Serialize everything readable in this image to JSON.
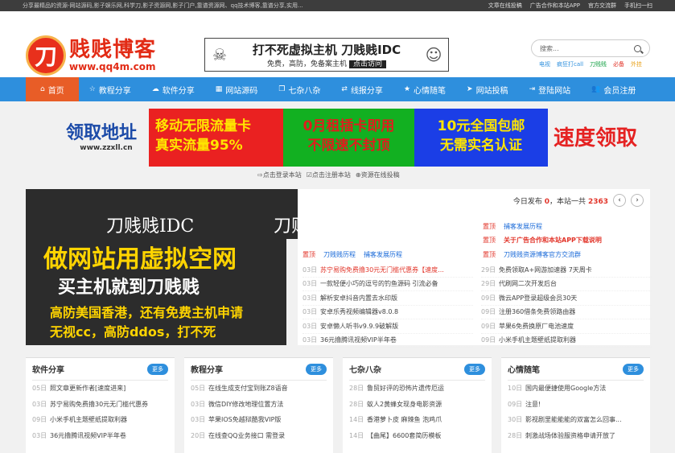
{
  "topbar": {
    "left_text": "分享最精品的资源-网站源码,影子娱乐网,科学刀,影子资源网,影子门户,靠谱资源网、qq技术博客,靠谱分享,实用...",
    "links": [
      "文章在线投稿",
      "广告合作和本站APP",
      "官方交流群",
      "手机扫一扫"
    ]
  },
  "logo": {
    "mark": "刀",
    "title": "贱贱博客",
    "url": "www.qq4m.com"
  },
  "top_ad": {
    "line1": "打不死虚拟主机 刀贱贱IDC",
    "line2": "免费，高防，免备案主机",
    "button": "点击访问"
  },
  "search": {
    "placeholder": "搜索..."
  },
  "hot_tags": [
    "电视",
    "疯狂打call",
    "刀贱贱",
    "必备",
    "外挂"
  ],
  "nav": [
    {
      "icon": "home-icon",
      "glyph": "⌂",
      "label": "首页"
    },
    {
      "icon": "star-icon",
      "glyph": "☆",
      "label": "教程分享"
    },
    {
      "icon": "cloud-icon",
      "glyph": "☁",
      "label": "软件分享"
    },
    {
      "icon": "grid-icon",
      "glyph": "▦",
      "label": "网站源码"
    },
    {
      "icon": "copy-icon",
      "glyph": "❐",
      "label": "七杂八杂"
    },
    {
      "icon": "share-icon",
      "glyph": "⇄",
      "label": "线报分享"
    },
    {
      "icon": "heart-icon",
      "glyph": "★",
      "label": "心情随笔"
    },
    {
      "icon": "send-icon",
      "glyph": "➤",
      "label": "网站投稿"
    },
    {
      "icon": "login-icon",
      "glyph": "⇥",
      "label": "登陆网站"
    },
    {
      "icon": "users-icon",
      "glyph": "👥",
      "label": "会员注册"
    }
  ],
  "banner": {
    "logo_text": "领取地址",
    "logo_url": "www.zzxll.cn",
    "red": [
      "移动无限流量卡",
      "真实流量95%"
    ],
    "green": [
      "0月租插卡即用",
      "不限速不封顶"
    ],
    "blue": [
      "10元全国包邮",
      "无需实名认证"
    ],
    "speed": "速度领取"
  },
  "sublinks": [
    "点击登录本站",
    "点击注册本站",
    "资源在线投稿"
  ],
  "slide": {
    "l1": "刀贱贱IDC",
    "l1b": "刀贱",
    "l2": "做网站用虚拟空网",
    "l3": "买主机就到刀贱贱",
    "l4": "高防美国香港，还有免费主机申请",
    "l5": "无视cc，高防ddos，打不死"
  },
  "news": {
    "today_label": "今日发布",
    "today_count": "0",
    "total_label": "本站一共",
    "total_count": "2363",
    "tag": "置顶",
    "tag_rows": [
      {
        "tag": "置顶",
        "title": "捕客发展历程"
      },
      {
        "tag": "置顶",
        "title": "刀贱贱历程",
        "title2": "捕客发展历程"
      },
      {
        "tag": "置顶",
        "title": "关于广告合作和本站APP下载说明"
      },
      {
        "tag": "置顶",
        "title": "刀贱贱资源博客官方交流群"
      }
    ],
    "left": [
      {
        "d": "03日",
        "t": "苏宁易购免费撸30元无门槛代惠券【速度..."
      },
      {
        "d": "03日",
        "t": "一款轻便小巧的逗号的钓鱼源码 引流必备"
      },
      {
        "d": "03日",
        "t": "解析安卓抖音内置去水印版"
      },
      {
        "d": "03日",
        "t": "安卓乐秀视频编辑器v8.0.8"
      },
      {
        "d": "03日",
        "t": "安卓懒人听书v9.9.9破解版"
      },
      {
        "d": "03日",
        "t": "36元撸腾讯视频VIP半年卷"
      }
    ],
    "right": [
      {
        "d": "29日",
        "t": "免费领取A+网游加速器 7天周卡"
      },
      {
        "d": "29日",
        "t": "代刷网二次开发后台"
      },
      {
        "d": "09日",
        "t": "微云APP登录超级会员30天"
      },
      {
        "d": "09日",
        "t": "注册360借条免费领路由器"
      },
      {
        "d": "09日",
        "t": "苹果6免费换原厂电池速度"
      },
      {
        "d": "09日",
        "t": "小米手机主题壁纸提取利器"
      }
    ]
  },
  "boxes": [
    {
      "title": "软件分享",
      "more": "更多",
      "rows": [
        {
          "d": "05日",
          "t": "照文章更新作者[速度进来]"
        },
        {
          "d": "03日",
          "t": "苏宁易购免费撸30元无门槛代惠券"
        },
        {
          "d": "09日",
          "t": "小米手机主题壁纸提取利器"
        },
        {
          "d": "03日",
          "t": "36元撸腾讯视频VIP半年卷"
        }
      ]
    },
    {
      "title": "教程分享",
      "more": "更多",
      "rows": [
        {
          "d": "05日",
          "t": "在线生成支付宝到账Z8语音"
        },
        {
          "d": "03日",
          "t": "微信DIY修改地理位置方法"
        },
        {
          "d": "03日",
          "t": "苹果IOS免越狱酷我VIP版"
        },
        {
          "d": "20日",
          "t": "在线查QQ业务接口 需登录"
        }
      ]
    },
    {
      "title": "七杂八杂",
      "more": "更多",
      "rows": [
        {
          "d": "28日",
          "t": "鲁贸好评的恐怖片遗传厄运"
        },
        {
          "d": "28日",
          "t": "蚁人2黄蜂女现身电影资源"
        },
        {
          "d": "14日",
          "t": "香港萝卜皮 麻辣鱼 泡鸡爪"
        },
        {
          "d": "14日",
          "t": "【曲尾】6600套简历模板"
        }
      ]
    },
    {
      "title": "心情随笔",
      "more": "更多",
      "rows": [
        {
          "d": "10日",
          "t": "国内最便捷使用Google方法"
        },
        {
          "d": "09日",
          "t": "注意!"
        },
        {
          "d": "30日",
          "t": "影视剧里能能能的双富怎么回事..."
        },
        {
          "d": "28日",
          "t": "刺激战场体验服资格申请开放了"
        }
      ]
    }
  ]
}
